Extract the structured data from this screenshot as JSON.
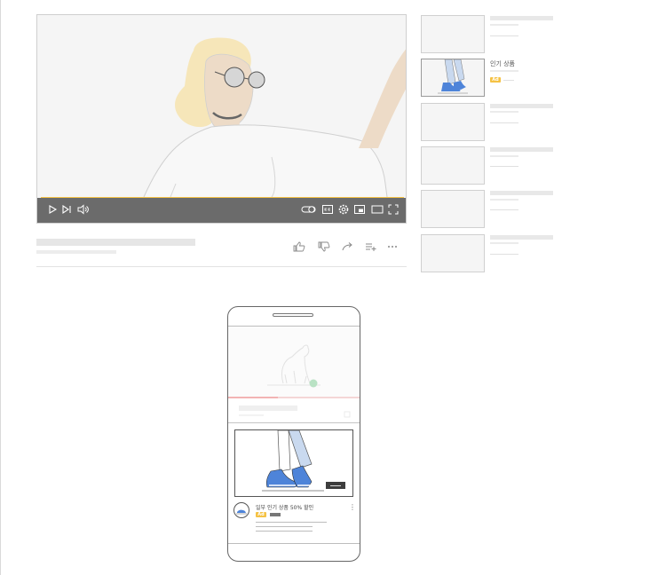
{
  "sidebar": {
    "ad_title": "인기 상품",
    "ad_badge": "Ad"
  },
  "phone": {
    "ad_title": "일부 인기 상품 50% 할인",
    "ad_badge": "Ad"
  },
  "colors": {
    "accent": "#f5c244",
    "controls_bar": "#6b6b6b",
    "shoe_blue": "#4e84d9",
    "jeans_blue": "#c9d9ef",
    "dot_green": "#b9e2c4"
  },
  "icons": {
    "player_controls": [
      "play-icon",
      "skip-next-icon",
      "volume-icon",
      "autoplay-toggle-icon",
      "captions-icon",
      "settings-icon",
      "miniplayer-icon",
      "theater-mode-icon",
      "fullscreen-icon"
    ],
    "actions": [
      "like-icon",
      "dislike-icon",
      "share-icon",
      "save-to-playlist-icon",
      "more-icon"
    ]
  }
}
